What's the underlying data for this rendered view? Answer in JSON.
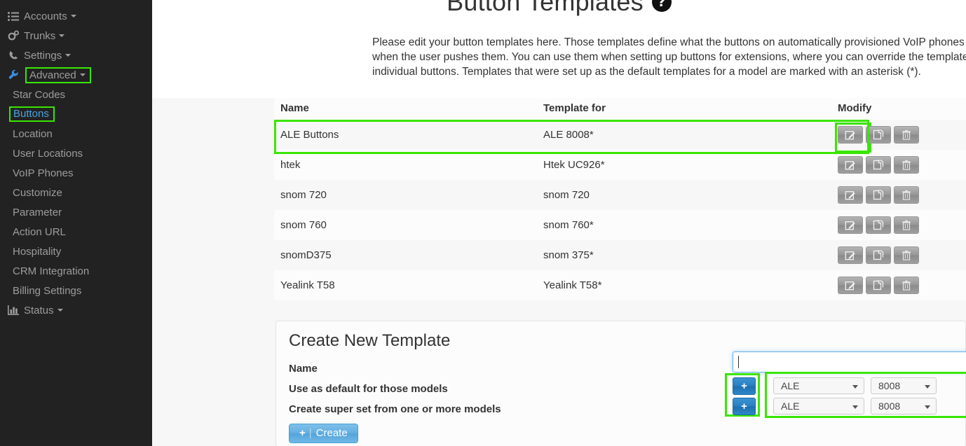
{
  "sidebar": {
    "top_items": [
      {
        "label": "Accounts",
        "icon": "list-icon",
        "caret": true,
        "highlighted": false
      },
      {
        "label": "Trunks",
        "icon": "gears-icon",
        "caret": true,
        "highlighted": false
      },
      {
        "label": "Settings",
        "icon": "phone-icon",
        "caret": true,
        "highlighted": false
      },
      {
        "label": "Advanced",
        "icon": "wrench-icon",
        "caret": true,
        "highlighted": true
      }
    ],
    "sub_items": [
      {
        "label": "Star Codes",
        "active": false,
        "highlighted": false
      },
      {
        "label": "Buttons",
        "active": true,
        "highlighted": true
      },
      {
        "label": "Location",
        "active": false,
        "highlighted": false
      },
      {
        "label": "User Locations",
        "active": false,
        "highlighted": false
      },
      {
        "label": "VoIP Phones",
        "active": false,
        "highlighted": false
      },
      {
        "label": "Customize",
        "active": false,
        "highlighted": false
      },
      {
        "label": "Parameter",
        "active": false,
        "highlighted": false
      },
      {
        "label": "Action URL",
        "active": false,
        "highlighted": false
      },
      {
        "label": "Hospitality",
        "active": false,
        "highlighted": false
      },
      {
        "label": "CRM Integration",
        "active": false,
        "highlighted": false
      },
      {
        "label": "Billing Settings",
        "active": false,
        "highlighted": false
      }
    ],
    "bottom_item": {
      "label": "Status",
      "icon": "bar-chart-icon",
      "caret": true
    }
  },
  "page": {
    "title": "Button Templates",
    "help_icon": "question-mark-icon",
    "description": "Please edit your button templates here. Those templates define what the buttons on automatically provisioned VoIP phones do when the user pushes them. You can use them when setting up buttons for extensions, where you can override the template for individual buttons. Templates that were set up as the default templates for a model are marked with an asterisk (*)."
  },
  "table": {
    "headers": [
      "Name",
      "Template for",
      "Modify"
    ],
    "row_actions": [
      "edit-icon",
      "copy-icon",
      "trash-icon"
    ],
    "rows": [
      {
        "name": "ALE Buttons",
        "template_for": "ALE 8008*",
        "highlighted": true
      },
      {
        "name": "htek",
        "template_for": "Htek UC926*",
        "highlighted": false
      },
      {
        "name": "snom 720",
        "template_for": "snom 720",
        "highlighted": false
      },
      {
        "name": "snom 760",
        "template_for": "snom 760*",
        "highlighted": false
      },
      {
        "name": "snomD375",
        "template_for": "snom 375*",
        "highlighted": false
      },
      {
        "name": "Yealink T58",
        "template_for": "Yealink T58*",
        "highlighted": false
      }
    ]
  },
  "create_panel": {
    "title": "Create New Template",
    "labels": {
      "name": "Name",
      "use_as_default": "Use as default for those models",
      "super_set": "Create super set from one or more models"
    },
    "name_input": {
      "value": "",
      "placeholder": ""
    },
    "add_buttons": [
      {
        "label": "+",
        "name": "add-default-model-button"
      },
      {
        "label": "+",
        "name": "add-superset-model-button"
      }
    ],
    "model_rows": [
      {
        "brand": "ALE",
        "model": "8008"
      },
      {
        "brand": "ALE",
        "model": "8008"
      }
    ],
    "create_button": {
      "plus": "+",
      "divider": "|",
      "label": "Create"
    }
  },
  "colors": {
    "highlight_green": "#39e600",
    "sidebar_bg": "#222222",
    "active_link": "#337ab7",
    "primary_blue": "#62aee0"
  }
}
